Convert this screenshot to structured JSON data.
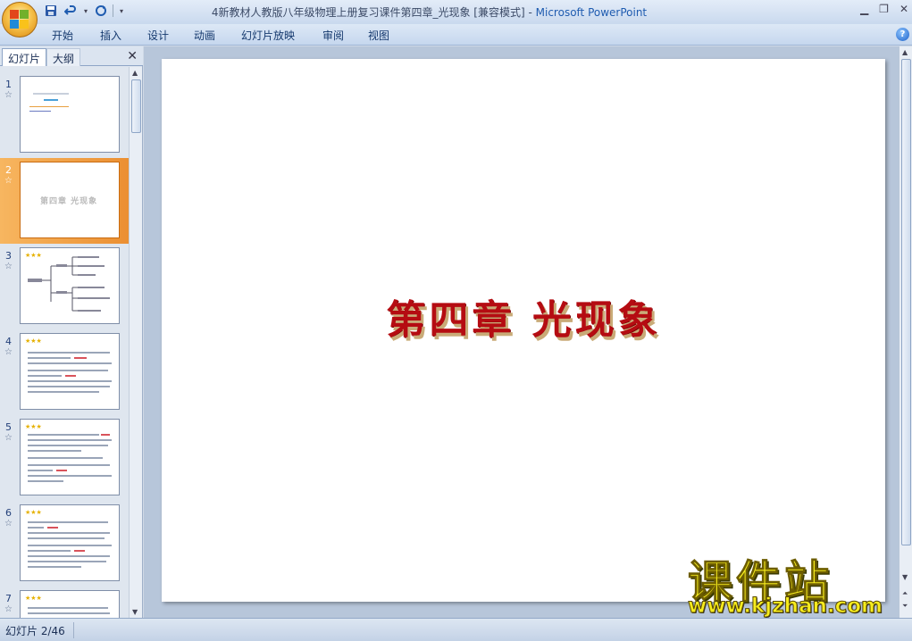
{
  "window": {
    "title_doc": "4新教材人教版八年级物理上册复习课件第四章_光现象 [兼容模式]",
    "title_sep": " - ",
    "title_app": "Microsoft PowerPoint"
  },
  "ribbon": {
    "tabs": [
      "开始",
      "插入",
      "设计",
      "动画",
      "幻灯片放映",
      "审阅",
      "视图"
    ]
  },
  "left_panel": {
    "tabs": {
      "slides": "幻灯片",
      "outline": "大纲"
    },
    "thumbnails": [
      {
        "num": "1",
        "star": "☆"
      },
      {
        "num": "2",
        "star": "☆",
        "text": "第四章 光现象"
      },
      {
        "num": "3",
        "star": "☆"
      },
      {
        "num": "4",
        "star": "☆"
      },
      {
        "num": "5",
        "star": "☆"
      },
      {
        "num": "6",
        "star": "☆"
      },
      {
        "num": "7",
        "star": "☆"
      }
    ]
  },
  "slide": {
    "title": "第四章 光现象"
  },
  "watermark": {
    "line1": "课件站",
    "line2": "www.kjzhan.com"
  },
  "statusbar": {
    "slide_info": "幻灯片 2/46"
  },
  "colors": {
    "title_red": "#b50c12",
    "selected_thumb": "#eb8f32",
    "watermark_yellow": "#f6ec1e"
  }
}
